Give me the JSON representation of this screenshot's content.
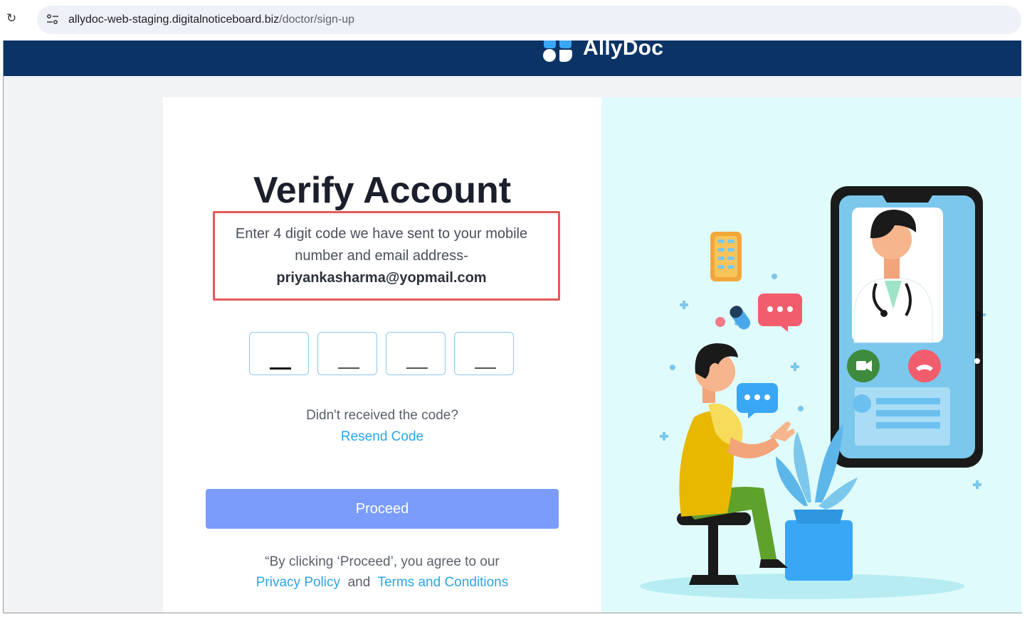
{
  "browser": {
    "url_host": "allydoc-web-staging.digitalnoticeboard.biz",
    "url_path": "/doctor/sign-up"
  },
  "header": {
    "brand": "AllyDoc"
  },
  "verify": {
    "title": "Verify Account",
    "message_line1": "Enter 4 digit code we have sent to your mobile",
    "message_line2": "number and email address-",
    "email": "priyankasharma@yopmail.com",
    "otp_boxes": [
      "",
      "",
      "",
      ""
    ],
    "not_received": "Didn't received the code?",
    "resend_label": "Resend Code",
    "proceed_label": "Proceed",
    "terms_line1": "“By clicking ‘Proceed’, you agree to our",
    "privacy_label": "Privacy Policy",
    "and_label": "and",
    "terms_label": "Terms and Conditions"
  },
  "colors": {
    "header_bg": "#0b3366",
    "accent": "#2aa5ea",
    "button": "#7b9cfb",
    "highlight": "#e35b5b",
    "panel_bg": "#e0fbfb"
  }
}
